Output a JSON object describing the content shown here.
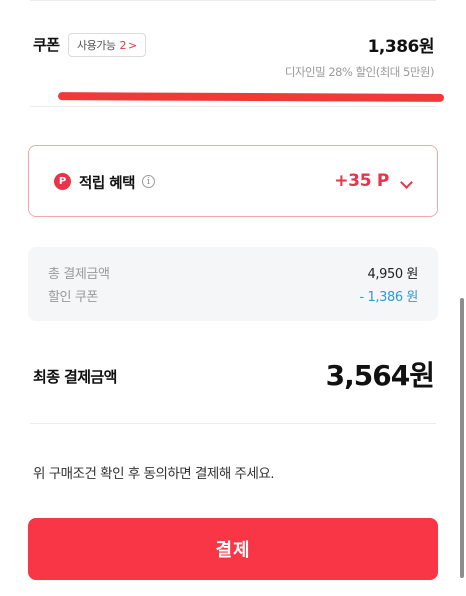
{
  "coupon": {
    "title": "쿠폰",
    "chip_label": "사용가능",
    "chip_count": "2",
    "chip_chevron": ">",
    "amount": "1,386원",
    "description": "디자인밀 28% 할인(최대 5만원)"
  },
  "points": {
    "icon_letter": "P",
    "label": "적립 혜택",
    "info": "i",
    "value": "+35 P"
  },
  "summary": {
    "total_label": "총 결제금액",
    "total_value": "4,950 원",
    "discount_label": "할인 쿠폰",
    "discount_value": "- 1,386 원"
  },
  "final": {
    "label": "최종 결제금액",
    "amount": "3,564원"
  },
  "notice": "위 구매조건 확인 후 동의하면 결제해 주세요.",
  "pay_button": "결제",
  "colors": {
    "accent": "#f83645",
    "highlight_underline": "#f03a3a",
    "discount_blue": "#2f9ad8"
  }
}
